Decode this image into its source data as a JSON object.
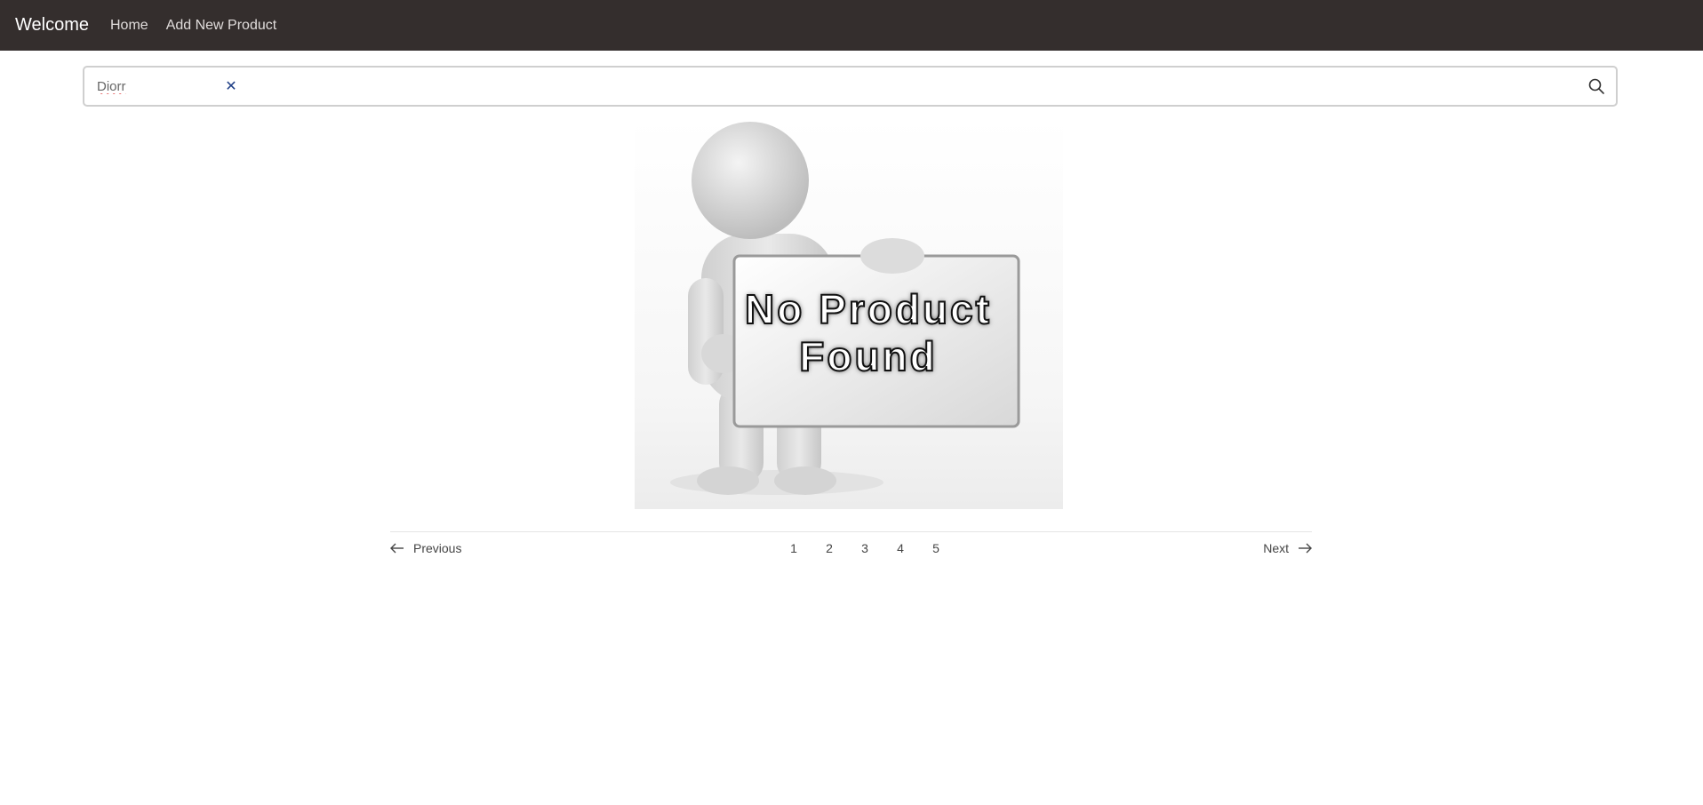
{
  "navbar": {
    "brand": "Welcome",
    "links": [
      "Home",
      "Add New Product"
    ]
  },
  "search": {
    "value": "Diorr",
    "clear_icon": "close-icon",
    "search_icon": "search-icon"
  },
  "empty_state": {
    "text_line1": "No Product",
    "text_line2": "Found"
  },
  "pagination": {
    "previous_label": "Previous",
    "next_label": "Next",
    "pages": [
      "1",
      "2",
      "3",
      "4",
      "5"
    ]
  },
  "colors": {
    "navbar_bg": "#342e2d",
    "clear_icon": "#1f3f86"
  }
}
